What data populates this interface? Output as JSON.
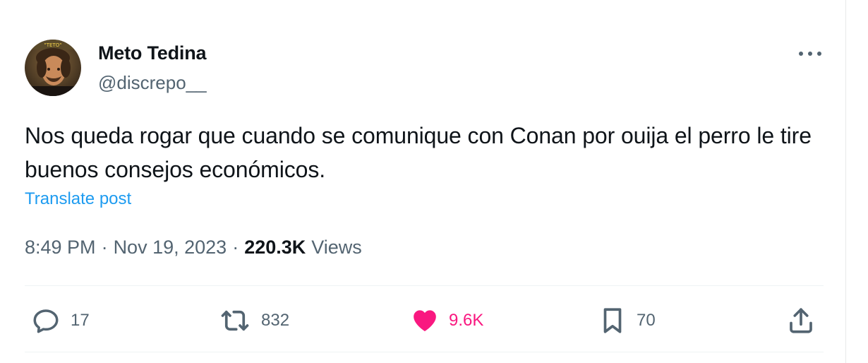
{
  "author": {
    "display_name": "Meto Tedina",
    "handle": "@discrepo__",
    "avatar_icon": "user-avatar-photo",
    "avatar_caption": "\"TETO\""
  },
  "post": {
    "text": "Nos queda rogar que cuando se comunique con Conan por ouija el perro le tire buenos consejos económicos.",
    "translate_label": "Translate post"
  },
  "meta": {
    "time": "8:49 PM",
    "separator": "·",
    "date": "Nov 19, 2023",
    "views_count": "220.3K",
    "views_label": "Views"
  },
  "actions": {
    "replies": {
      "icon": "reply-icon",
      "count": "17"
    },
    "reposts": {
      "icon": "repost-icon",
      "count": "832"
    },
    "likes": {
      "icon": "heart-icon",
      "count": "9.6K",
      "liked": true
    },
    "bookmarks": {
      "icon": "bookmark-icon",
      "count": "70"
    },
    "share": {
      "icon": "share-icon"
    }
  },
  "colors": {
    "text_primary": "#0f1419",
    "text_secondary": "#536471",
    "link": "#1d9bf0",
    "like_active": "#f91880",
    "divider": "#eff3f4"
  }
}
